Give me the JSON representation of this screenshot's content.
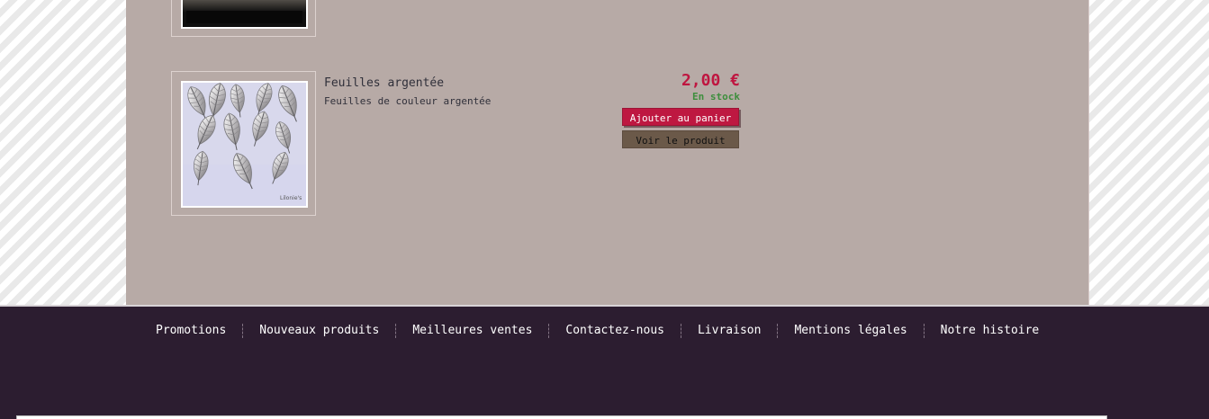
{
  "product": {
    "name": "Feuilles argentée",
    "description": "Feuilles de couleur argentée",
    "price": "2,00 €",
    "stock": "En stock",
    "image_watermark": "Lilonie's",
    "actions": {
      "add_to_cart": "Ajouter au panier",
      "view_product": "Voir le produit"
    }
  },
  "footer": {
    "links": [
      "Promotions",
      "Nouveaux produits",
      "Meilleures ventes",
      "Contactez-nous",
      "Livraison",
      "Mentions légales",
      "Notre histoire"
    ]
  },
  "colors": {
    "content_background": "#b7aaa6",
    "footer_background": "#2c1d30",
    "price_text": "#bf1640",
    "stock_text": "#3d8e3c",
    "cart_button": "#be1841",
    "view_button": "#6b5949"
  },
  "icons": {
    "previous_product_image": "product-photo",
    "current_product_image": "silver-leaves-photo"
  }
}
